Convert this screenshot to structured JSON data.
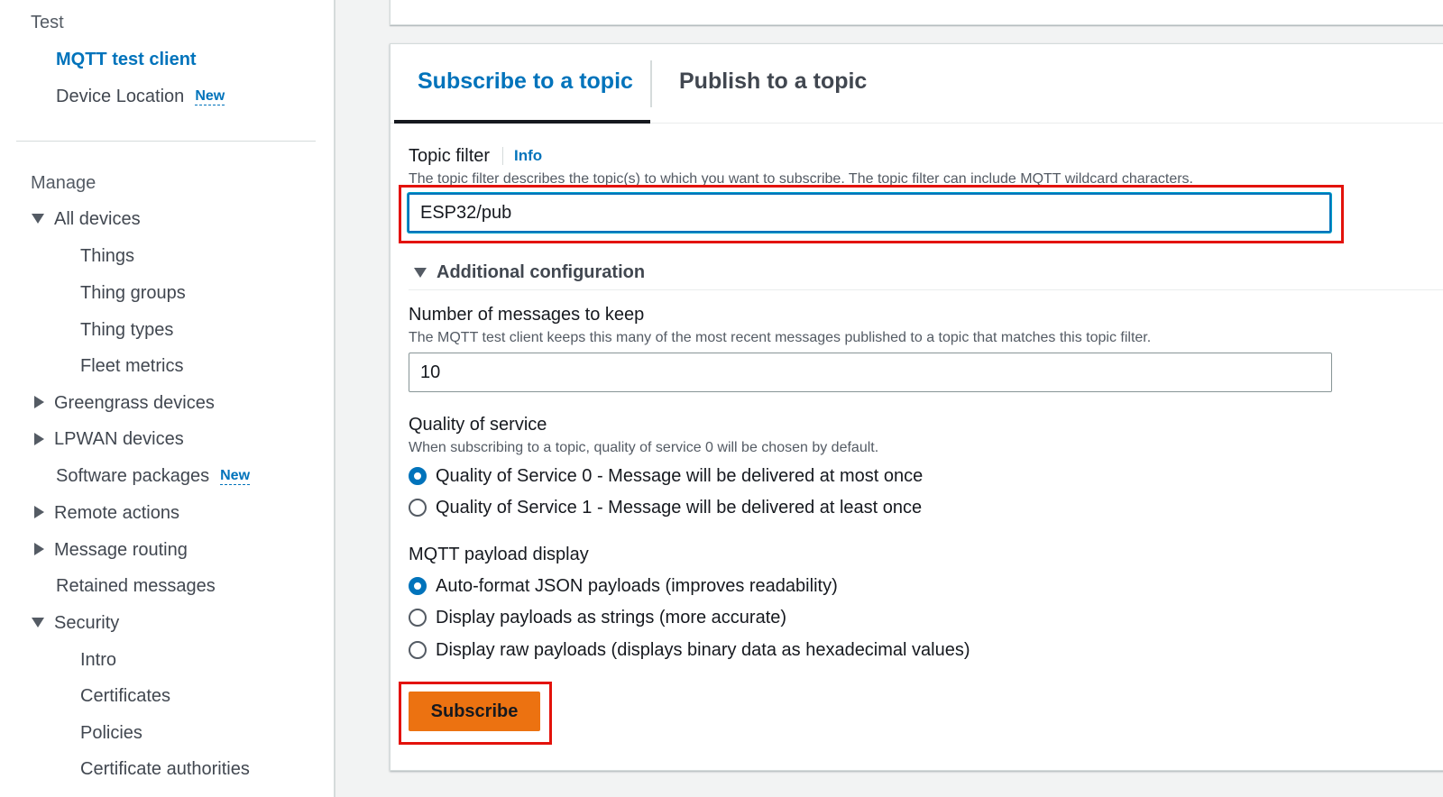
{
  "sidebar": {
    "test_section": "Test",
    "mqtt_test_client": "MQTT test client",
    "device_location": "Device Location",
    "new_badge": "New",
    "manage_section": "Manage",
    "all_devices": "All devices",
    "things": "Things",
    "thing_groups": "Thing groups",
    "thing_types": "Thing types",
    "fleet_metrics": "Fleet metrics",
    "greengrass_devices": "Greengrass devices",
    "lpwan_devices": "LPWAN devices",
    "software_packages": "Software packages",
    "remote_actions": "Remote actions",
    "message_routing": "Message routing",
    "retained_messages": "Retained messages",
    "security": "Security",
    "intro": "Intro",
    "certificates": "Certificates",
    "policies": "Policies",
    "certificate_authorities": "Certificate authorities"
  },
  "tabs": {
    "subscribe": "Subscribe to a topic",
    "publish": "Publish to a topic"
  },
  "topic_filter": {
    "label": "Topic filter",
    "info": "Info",
    "description": "The topic filter describes the topic(s) to which you want to subscribe. The topic filter can include MQTT wildcard characters.",
    "value": "ESP32/pub"
  },
  "additional_config": {
    "label": "Additional configuration"
  },
  "messages_to_keep": {
    "label": "Number of messages to keep",
    "description": "The MQTT test client keeps this many of the most recent messages published to a topic that matches this topic filter.",
    "value": "10"
  },
  "qos": {
    "label": "Quality of service",
    "description": "When subscribing to a topic, quality of service 0 will be chosen by default.",
    "option0": "Quality of Service 0 - Message will be delivered at most once",
    "option1": "Quality of Service 1 - Message will be delivered at least once",
    "selected": "Quality of Service 0 - Message will be delivered at most once"
  },
  "payload_display": {
    "label": "MQTT payload display",
    "option_json": "Auto-format JSON payloads (improves readability)",
    "option_strings": "Display payloads as strings (more accurate)",
    "option_raw": "Display raw payloads (displays binary data as hexadecimal values)",
    "selected": "Auto-format JSON payloads (improves readability)"
  },
  "subscribe_button": "Subscribe",
  "colors": {
    "link": "#0073bb",
    "primary_button": "#ec7211",
    "highlight": "#e3120b"
  }
}
